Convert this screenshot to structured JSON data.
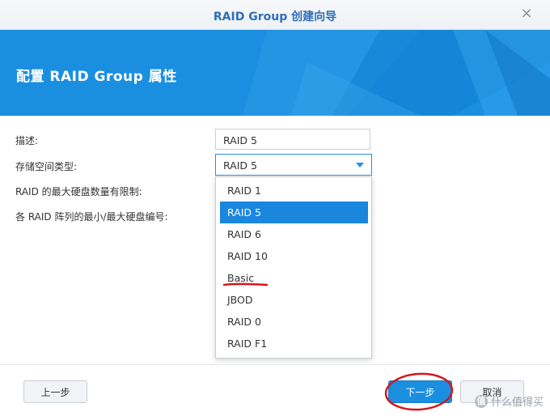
{
  "window": {
    "title": "RAID Group 创建向导",
    "close_icon": "×"
  },
  "banner": {
    "heading": "配置 RAID Group 属性",
    "color": "#1a8fe0"
  },
  "form": {
    "description_label": "描述:",
    "description_value": "RAID 5",
    "storage_type_label": "存储空间类型:",
    "storage_type_value": "RAID 5",
    "max_disks_label": "RAID 的最大硬盘数量有限制:",
    "min_max_label": "各 RAID 阵列的最小/最大硬盘编号:"
  },
  "dropdown": {
    "options": [
      "RAID 1",
      "RAID 5",
      "RAID 6",
      "RAID 10",
      "Basic",
      "JBOD",
      "RAID 0",
      "RAID F1"
    ],
    "selected": "RAID 5"
  },
  "footer": {
    "prev_label": "上一步",
    "next_label": "下一步",
    "cancel_label": "取消"
  },
  "watermark": {
    "logo": "值",
    "text": "什么值得买"
  },
  "annotation_color": "#d9141b"
}
